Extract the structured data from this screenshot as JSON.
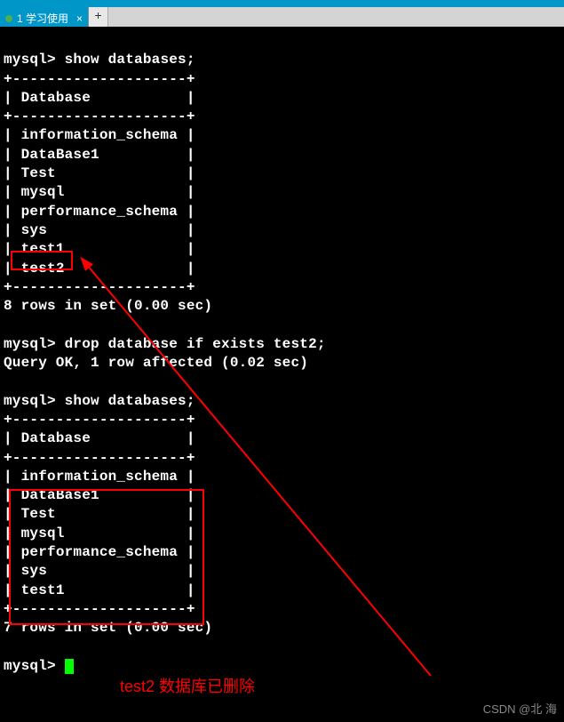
{
  "tabs": [
    {
      "label": "1 学习使用"
    }
  ],
  "terminal": {
    "prompt1": "mysql>",
    "cmd1": "show databases;",
    "cmd2": "drop database if exists test2;",
    "cmd3": "show databases;",
    "border": "+--------------------+",
    "header": "| Database           |",
    "dbs1": [
      "information_schema",
      "DataBase1",
      "Test",
      "mysql",
      "performance_schema",
      "sys",
      "test1",
      "test2"
    ],
    "dbs2": [
      "information_schema",
      "DataBase1",
      "Test",
      "mysql",
      "performance_schema",
      "sys",
      "test1"
    ],
    "result1": "8 rows in set (0.00 sec)",
    "result2": "Query OK, 1 row affected (0.02 sec)",
    "result3": "7 rows in set (0.00 sec)"
  },
  "annotation": {
    "text": "test2 数据库已删除"
  },
  "watermark": "CSDN @北  海"
}
